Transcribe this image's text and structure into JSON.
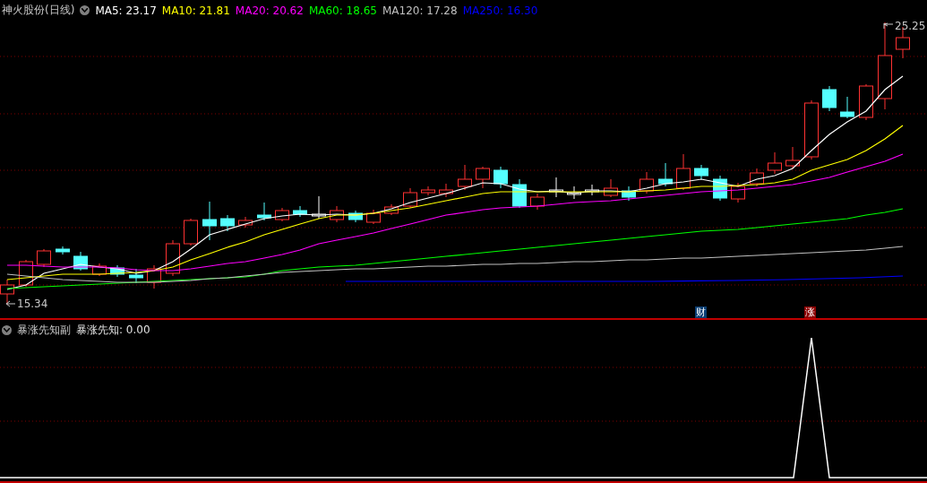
{
  "main_chart": {
    "title": "神火股份(日线)",
    "ma_legend": [
      {
        "label": "MA5: 23.17",
        "color": "#ffffff"
      },
      {
        "label": "MA10: 21.81",
        "color": "#ffff00"
      },
      {
        "label": "MA20: 20.62",
        "color": "#ff00ff"
      },
      {
        "label": "MA60: 18.65",
        "color": "#00ff00"
      },
      {
        "label": "MA120: 17.28",
        "color": "#c0c0c0"
      },
      {
        "label": "MA250: 16.30",
        "color": "#0000ff"
      }
    ],
    "high_label": "25.25",
    "low_label": "15.34",
    "markers": [
      {
        "label": "财",
        "color": "#0a3e73"
      },
      {
        "label": "涨",
        "color": "#8b0000"
      }
    ]
  },
  "indicator": {
    "title": "暴涨先知副",
    "reading": "暴涨先知: 0.00"
  }
}
